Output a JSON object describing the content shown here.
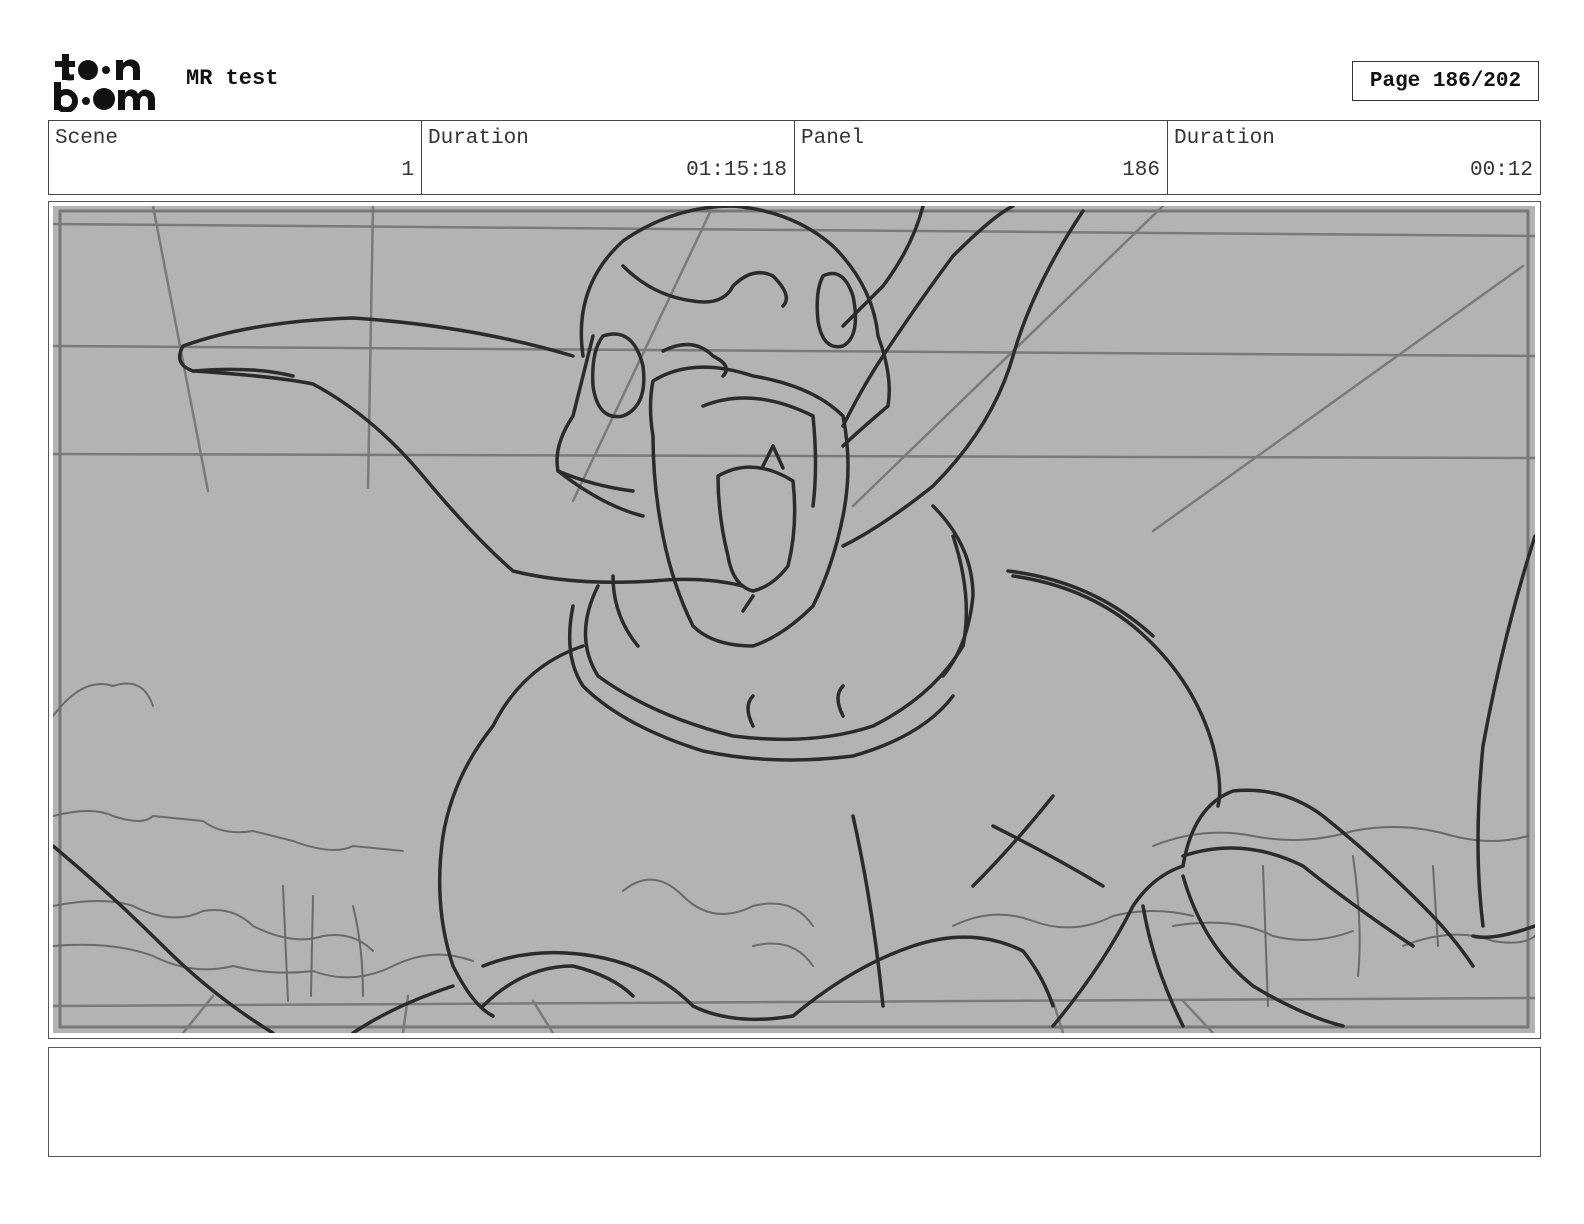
{
  "header": {
    "logo_name": "toon boom",
    "project_title": "MR test",
    "page_label": "Page 186/202"
  },
  "info": {
    "scene": {
      "label": "Scene",
      "value": "1"
    },
    "scene_duration": {
      "label": "Duration",
      "value": "01:15:18"
    },
    "panel": {
      "label": "Panel",
      "value": "186"
    },
    "panel_duration": {
      "label": "Duration",
      "value": "00:12"
    }
  },
  "panel_image": {
    "description_icon": "storyboard-sketch",
    "background_color": "#b3b3b3",
    "line_color": "#2b2b2b"
  },
  "notes": {
    "text": ""
  }
}
